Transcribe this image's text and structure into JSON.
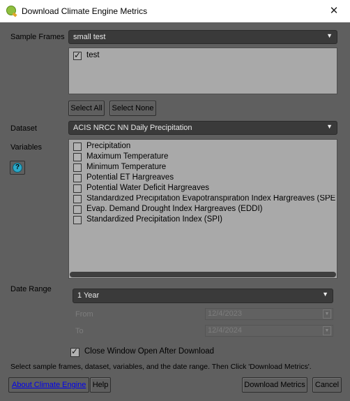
{
  "window": {
    "title": "Download Climate Engine Metrics",
    "close_glyph": "✕"
  },
  "sample_frames": {
    "label": "Sample Frames",
    "selected": "small test",
    "items": [
      {
        "label": "test",
        "checked": true
      }
    ],
    "select_all": "Select All",
    "select_none": "Select None"
  },
  "dataset": {
    "label": "Dataset",
    "selected": "ACIS NRCC NN Daily Precipitation"
  },
  "variables": {
    "label": "Variables",
    "help_glyph": "?",
    "items": [
      {
        "label": "Precipitation",
        "checked": false
      },
      {
        "label": "Maximum Temperature",
        "checked": false
      },
      {
        "label": "Minimum Temperature",
        "checked": false
      },
      {
        "label": "Potential ET Hargreaves",
        "checked": false
      },
      {
        "label": "Potential Water Deficit Hargreaves",
        "checked": false
      },
      {
        "label": "Standardized Precipitation Evapotranspiration Index Hargreaves (SPE",
        "checked": false
      },
      {
        "label": "Evap. Demand Drought Index Hargreaves (EDDI)",
        "checked": false
      },
      {
        "label": "Standardized Precipitation Index (SPI)",
        "checked": false
      }
    ]
  },
  "date_range": {
    "label": "Date Range",
    "selected": "1 Year",
    "from_label": "From",
    "from_value": "12/4/2023",
    "to_label": "To",
    "to_value": "12/4/2024"
  },
  "close_after_download": {
    "label": "Close Window Open After Download",
    "checked": true
  },
  "instructions": "Select sample frames, dataset, variables, and the date range. Then Click 'Download Metrics'.",
  "buttons": {
    "about": "About Climate Engine",
    "help": "Help",
    "download": "Download Metrics",
    "cancel": "Cancel"
  }
}
